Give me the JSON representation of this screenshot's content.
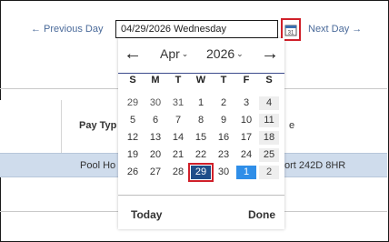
{
  "nav": {
    "prev_label": "← Previous Day",
    "date_value": "04/29/2026 Wednesday",
    "next_label": "Next Day →",
    "calendar_icon_text": "31"
  },
  "table": {
    "header_pay": "Pay Typ",
    "header_tail": "e",
    "row_pool": "Pool Ho",
    "row_tail": "ort 242D 8HR"
  },
  "calendar": {
    "month": "Apr",
    "year": "2026",
    "prev_arrow": "←",
    "next_arrow": "→",
    "chevron": "⌄",
    "weekdays": [
      "S",
      "M",
      "T",
      "W",
      "T",
      "F",
      "S"
    ],
    "weeks": [
      [
        "29",
        "30",
        "31",
        "1",
        "2",
        "3",
        "4"
      ],
      [
        "5",
        "6",
        "7",
        "8",
        "9",
        "10",
        "11"
      ],
      [
        "12",
        "13",
        "14",
        "15",
        "16",
        "17",
        "18"
      ],
      [
        "19",
        "20",
        "21",
        "22",
        "23",
        "24",
        "25"
      ],
      [
        "26",
        "27",
        "28",
        "29",
        "30",
        "1",
        "2"
      ]
    ],
    "selected": "29",
    "highlight_next_month_day": "1",
    "today_label": "Today",
    "done_label": "Done"
  },
  "colors": {
    "accent": "#1e4f8a",
    "today_blue": "#2f8ee8",
    "highlight_red": "#d0202a",
    "row_highlight": "#cfdcec"
  }
}
